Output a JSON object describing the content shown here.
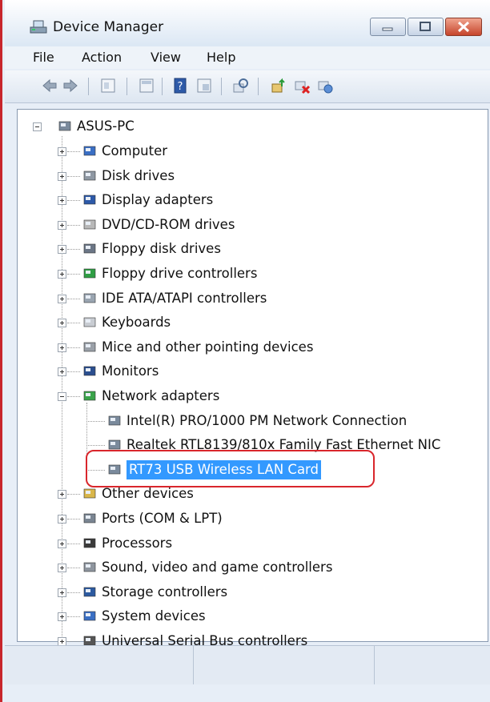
{
  "window": {
    "title": "Device Manager"
  },
  "menu": [
    "File",
    "Action",
    "View",
    "Help"
  ],
  "toolbar": {
    "icons": [
      "back-icon",
      "forward-icon",
      "properties-icon",
      "show-hide-tree-icon",
      "help-icon",
      "view-icon",
      "scan-hardware-icon",
      "update-driver-icon",
      "disable-device-icon",
      "uninstall-device-icon"
    ]
  },
  "tree": {
    "root": "ASUS-PC",
    "categories": [
      "Computer",
      "Disk drives",
      "Display adapters",
      "DVD/CD-ROM drives",
      "Floppy disk drives",
      "Floppy drive controllers",
      "IDE ATA/ATAPI controllers",
      "Keyboards",
      "Mice and other pointing devices",
      "Monitors",
      "Network adapters",
      "Other devices",
      "Ports (COM & LPT)",
      "Processors",
      "Sound, video and game controllers",
      "Storage controllers",
      "System devices",
      "Universal Serial Bus controllers"
    ],
    "network_children": [
      "Intel(R) PRO/1000 PM Network Connection",
      "Realtek RTL8139/810x Family Fast Ethernet NIC",
      "RT73 USB Wireless LAN Card"
    ],
    "selected": "RT73 USB Wireless LAN Card"
  },
  "colors": {
    "selection": "#3399ff",
    "highlight_border": "#d9262c"
  }
}
